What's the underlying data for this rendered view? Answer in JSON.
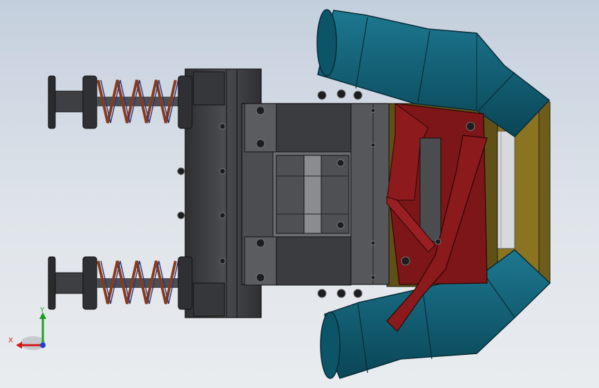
{
  "viewport": {
    "background_top": "#c4cfdd",
    "background_bottom": "#e9ecef"
  },
  "model": {
    "frame_color": "#3a3c3f",
    "plate_color": "#4b4d50",
    "guard_color": "#7c1618",
    "duct_color": "#0f5c72",
    "hopper_color": "#6e5c1a",
    "spring_color": "#8a3a1a"
  },
  "triad": {
    "x_label": "X",
    "y_label": "Y",
    "x_color": "#d41818",
    "y_color": "#1aa01a",
    "z_color": "#1b3fd6"
  }
}
